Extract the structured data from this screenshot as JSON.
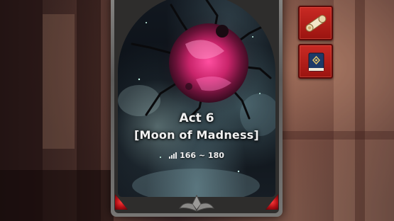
{
  "card": {
    "act_label": "Act 6",
    "act_name": "[Moon of Madness]",
    "level_range": "166 ~ 180",
    "level_icon": "signal-bars-icon",
    "moon_color": "#e0306e"
  },
  "side_buttons": [
    {
      "icon": "scroll-icon"
    },
    {
      "icon": "book-icon"
    }
  ],
  "colors": {
    "button_red": "#c92a24",
    "gem_red": "#ff3b3b",
    "frame_gray": "#8a8987"
  }
}
